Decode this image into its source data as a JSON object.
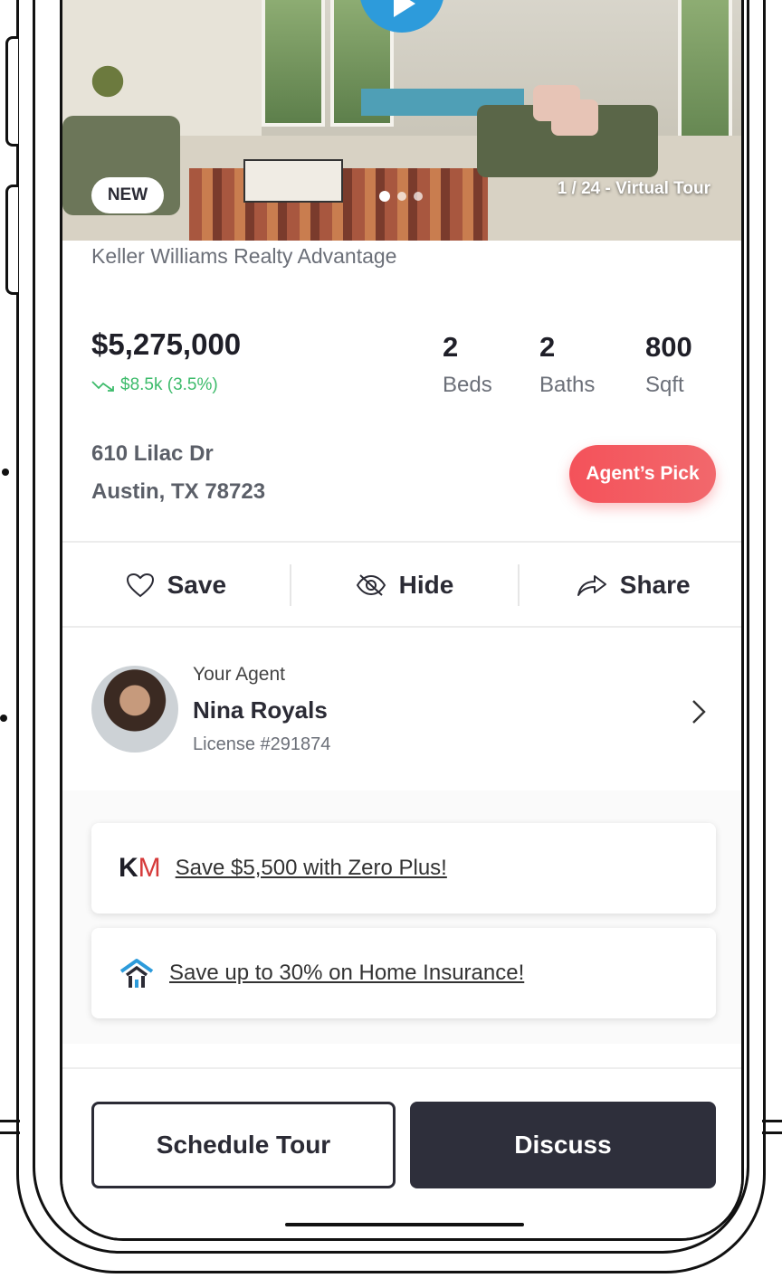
{
  "listing": {
    "badge": "NEW",
    "media_counter": "1 / 24 - Virtual Tour",
    "brokerage": "Keller Williams Realty Advantage",
    "price": "$5,275,000",
    "price_change": "$8.5k (3.5%)",
    "stats": [
      {
        "value": "2",
        "label": "Beds"
      },
      {
        "value": "2",
        "label": "Baths"
      },
      {
        "value": "800",
        "label": "Sqft"
      }
    ],
    "address_line1": "610 Lilac Dr",
    "address_line2": "Austin, TX 78723",
    "pick_label": "Agent’s Pick"
  },
  "actions": {
    "save": "Save",
    "hide": "Hide",
    "share": "Share"
  },
  "agent": {
    "caption": "Your Agent",
    "name": "Nina Royals",
    "license": "License #291874"
  },
  "promos": [
    {
      "text": "Save $5,500 with Zero Plus!",
      "logo_k": "K",
      "logo_m": "M"
    },
    {
      "text": "Save up to 30% on Home Insurance!"
    }
  ],
  "footer": {
    "schedule": "Schedule Tour",
    "discuss": "Discuss"
  },
  "colors": {
    "accent_red": "#f4525a",
    "change_green": "#3dbb6b",
    "play_blue": "#2d9bdb",
    "dark_button": "#2e2f3b"
  }
}
